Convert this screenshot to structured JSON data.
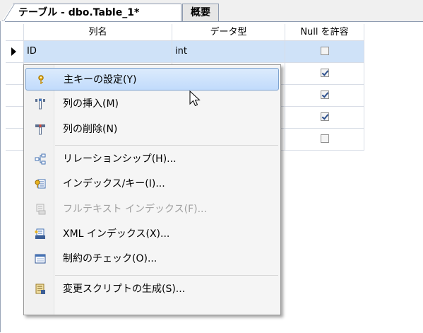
{
  "tabs": [
    {
      "label": "テーブル - dbo.Table_1*",
      "active": true
    },
    {
      "label": "概要",
      "active": false
    }
  ],
  "grid": {
    "headers": [
      "列名",
      "データ型",
      "Null を許容"
    ],
    "rows": [
      {
        "name": "ID",
        "type": "int",
        "allow_null": false,
        "selected": true
      },
      {
        "name": "",
        "type": "",
        "allow_null": true,
        "selected": false
      },
      {
        "name": "",
        "type": "",
        "allow_null": true,
        "selected": false
      },
      {
        "name": "",
        "type": "",
        "allow_null": true,
        "selected": false
      },
      {
        "name": "",
        "type": "",
        "allow_null": false,
        "selected": false
      }
    ]
  },
  "context_menu": {
    "items": [
      {
        "label": "主キーの設定(Y)",
        "icon": "key-icon",
        "highlighted": true,
        "enabled": true
      },
      {
        "label": "列の挿入(M)",
        "icon": "insert-column-icon",
        "highlighted": false,
        "enabled": true
      },
      {
        "label": "列の削除(N)",
        "icon": "delete-column-icon",
        "highlighted": false,
        "enabled": true
      },
      {
        "label": "リレーションシップ(H)...",
        "icon": "relationship-icon",
        "highlighted": false,
        "enabled": true
      },
      {
        "label": "インデックス/キー(I)...",
        "icon": "index-key-icon",
        "highlighted": false,
        "enabled": true
      },
      {
        "label": "フルテキスト インデックス(F)...",
        "icon": "fulltext-index-icon",
        "highlighted": false,
        "enabled": false
      },
      {
        "label": "XML インデックス(X)...",
        "icon": "xml-index-icon",
        "highlighted": false,
        "enabled": true
      },
      {
        "label": "制約のチェック(O)...",
        "icon": "check-constraint-icon",
        "highlighted": false,
        "enabled": true
      },
      {
        "label": "変更スクリプトの生成(S)...",
        "icon": "generate-script-icon",
        "highlighted": false,
        "enabled": true
      }
    ]
  },
  "colors": {
    "selection": "#cfe2f8",
    "menu_highlight": "#c1dbfc",
    "menu_border": "#7da2ce"
  }
}
